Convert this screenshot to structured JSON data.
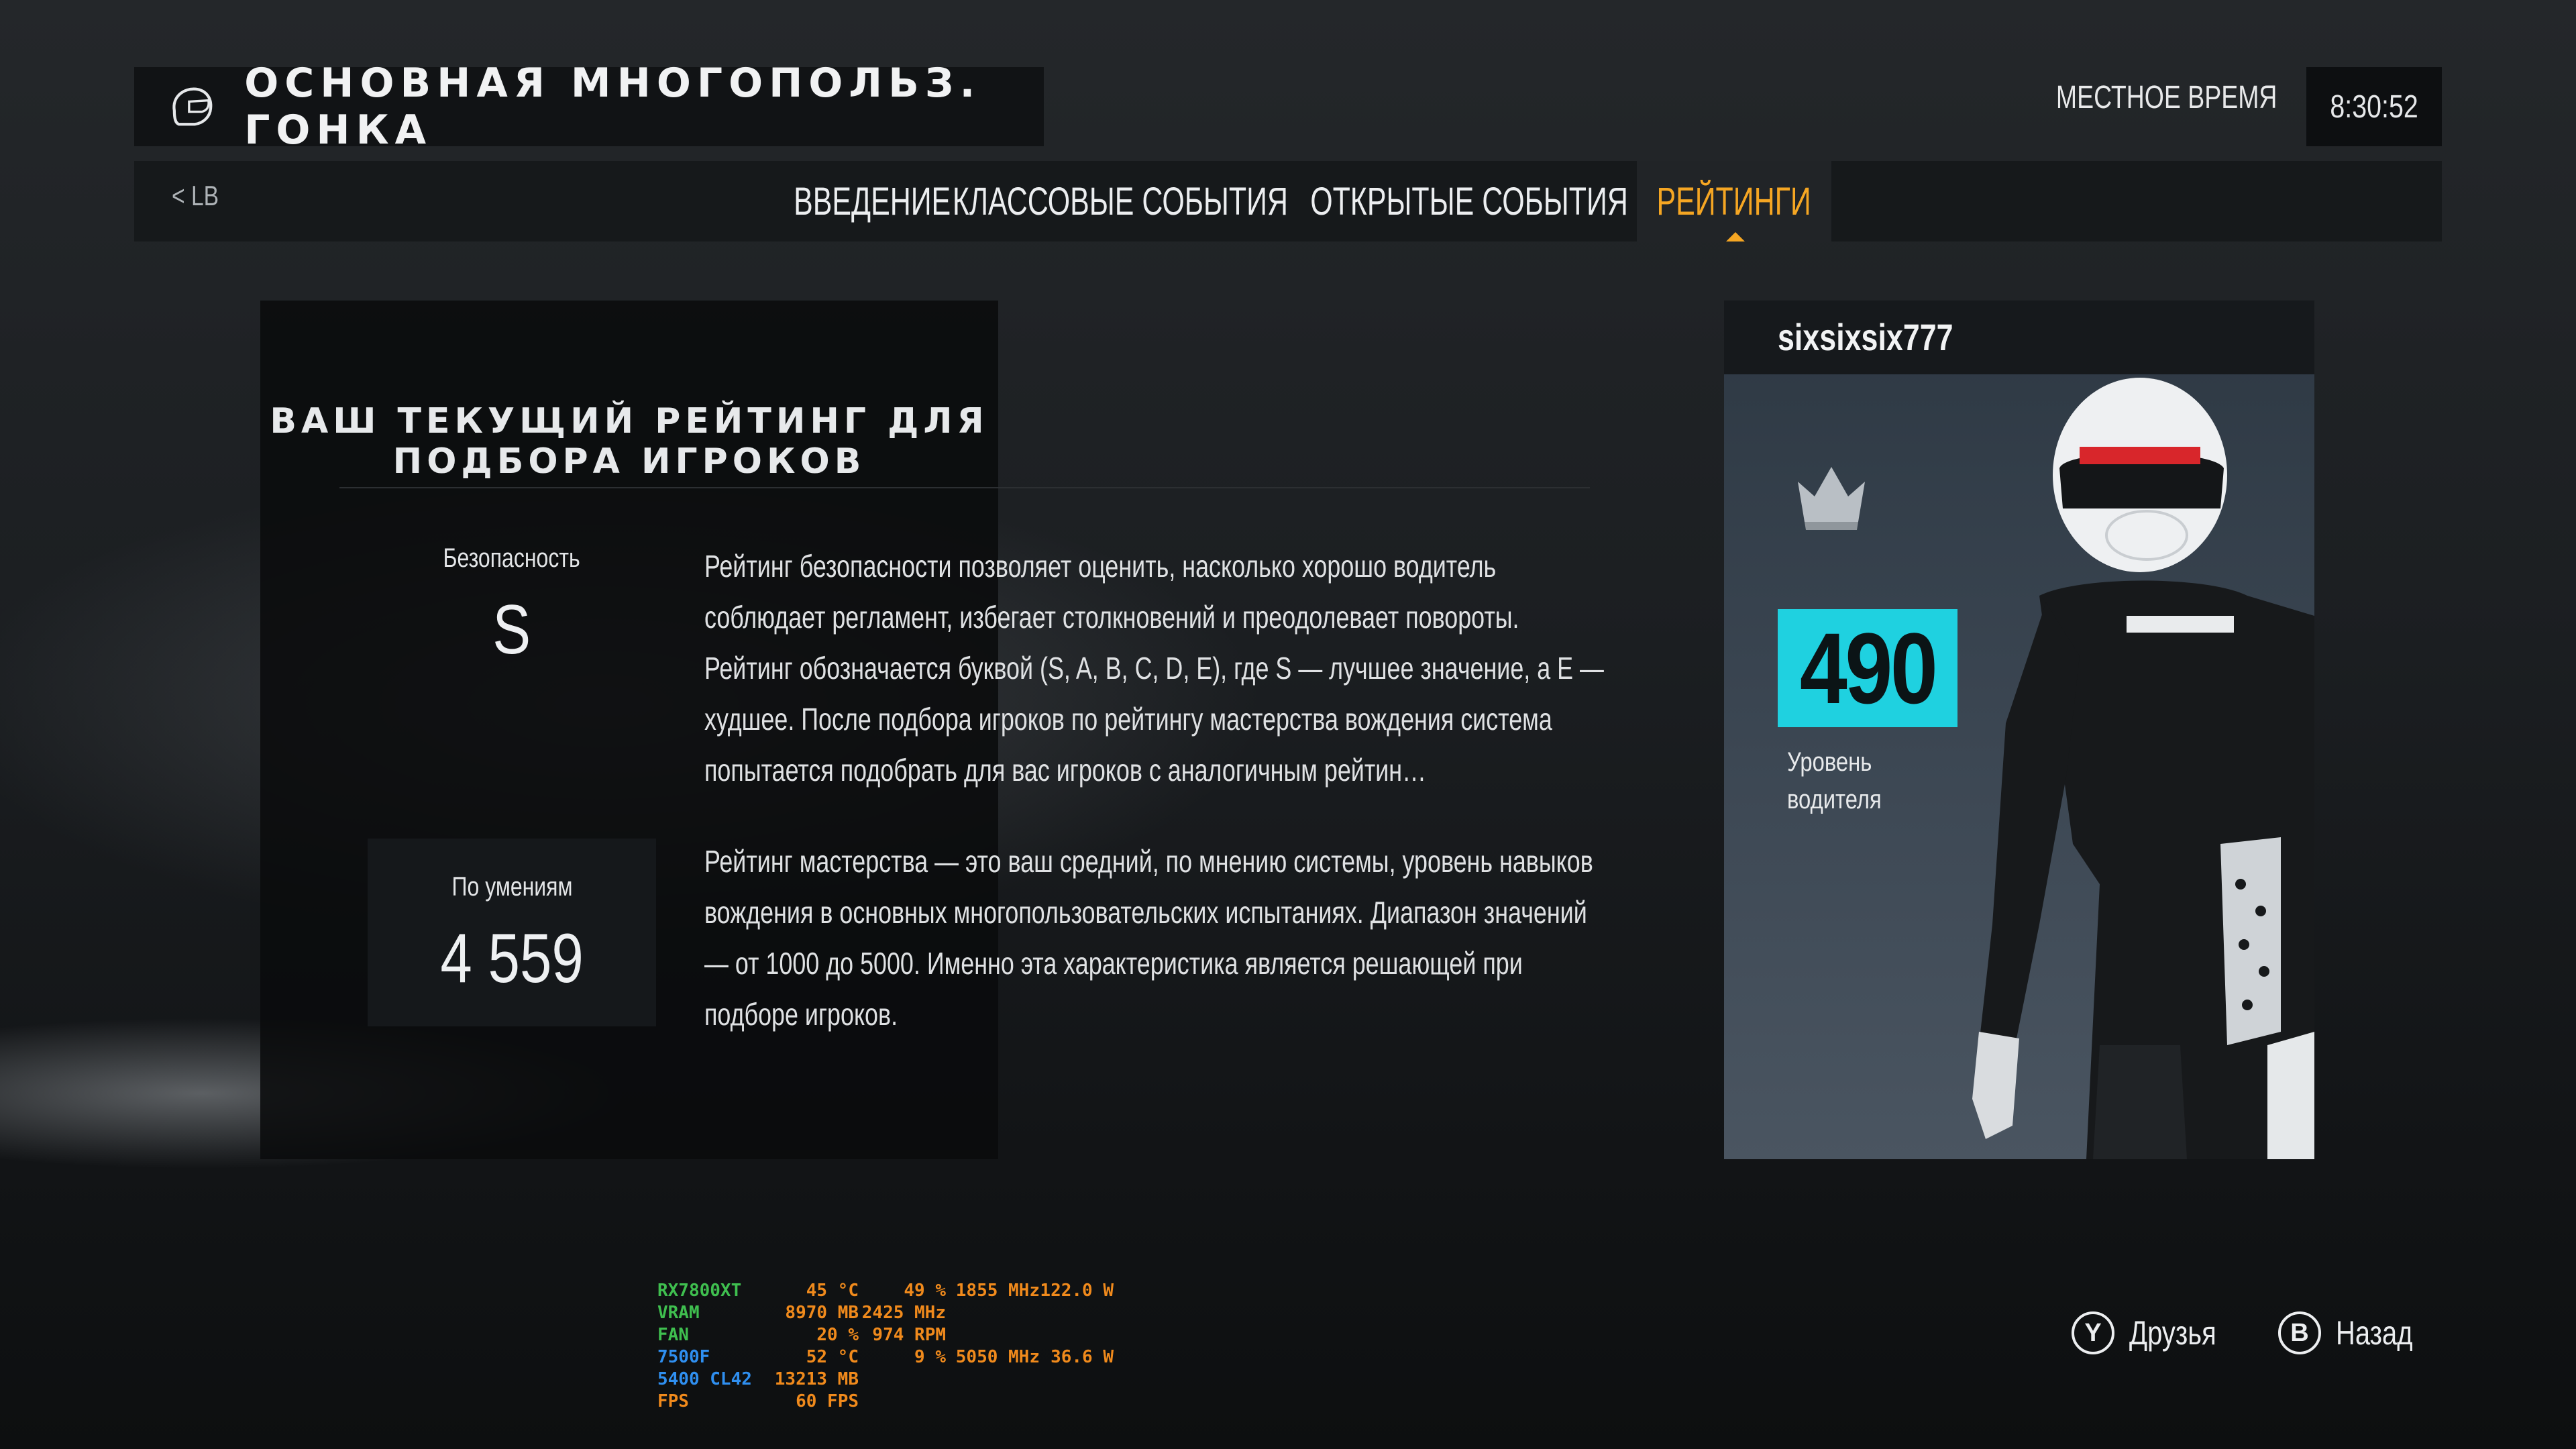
{
  "header": {
    "title": "ОСНОВНАЯ МНОГОПОЛЬЗ. ГОНКА",
    "local_time_label": "МЕСТНОЕ ВРЕМЯ",
    "time": "8:30:52"
  },
  "nav": {
    "bumper_left": "< LB",
    "tabs": [
      {
        "label": "ВВЕДЕНИЕ",
        "active": false
      },
      {
        "label": "КЛАССОВЫЕ СОБЫТИЯ",
        "active": false
      },
      {
        "label": "ОТКРЫТЫЕ СОБЫТИЯ",
        "active": false
      },
      {
        "label": "РЕЙТИНГИ",
        "active": true
      }
    ],
    "active_color": "#f5a623"
  },
  "rating": {
    "heading": "ВАШ ТЕКУЩИЙ РЕЙТИНГ ДЛЯ ПОДБОРА ИГРОКОВ",
    "safety": {
      "label": "Безопасность",
      "value": "S",
      "description": "Рейтинг безопасности позволяет оценить, насколько хорошо водитель соблюдает регламент, избегает столкновений и преодолевает повороты. Рейтинг обозначается буквой (S, A, B, C, D, E), где S — лучшее значение, а E — худшее. После подбора игроков по рейтингу мастерства вождения система попытается подобрать для вас игроков с аналогичным рейтин…"
    },
    "skill": {
      "label": "По умениям",
      "value": "4 559",
      "description": "Рейтинг мастерства — это ваш средний, по мнению системы, уровень навыков вождения в основных многопользовательских испытаниях. Диапазон значений — от 1000 до 5000. Именно эта характеристика является решающей при подборе игроков."
    }
  },
  "driver": {
    "name": "sixsixsix777",
    "level": "490",
    "level_label": "Уровень водителя",
    "badge_color": "#1fd1e0",
    "crown_icon": "crown-icon"
  },
  "hw_overlay": {
    "rows": [
      {
        "key": "RX7800XT",
        "key_color": "#3fbf4f",
        "c1": "45 °C",
        "c2": "49 %",
        "c3": "1855 MHz",
        "c4": "122.0 W"
      },
      {
        "key": "VRAM",
        "key_color": "#3fbf4f",
        "c1": "8970 MB",
        "c2": "2425 MHz",
        "c3": "",
        "c4": ""
      },
      {
        "key": "FAN",
        "key_color": "#3fbf4f",
        "c1": "20 %",
        "c2": "974 RPM",
        "c3": "",
        "c4": ""
      },
      {
        "key": "7500F",
        "key_color": "#2f8ff0",
        "c1": "52 °C",
        "c2": "9 %",
        "c3": "5050 MHz",
        "c4": "36.6 W"
      },
      {
        "key": "5400 CL42",
        "key_color": "#2f8ff0",
        "c1": "13213 MB",
        "c2": "",
        "c3": "",
        "c4": ""
      },
      {
        "key": "FPS",
        "key_color": "#f08a1c",
        "c1": "60 FPS",
        "c2": "",
        "c3": "",
        "c4": ""
      }
    ]
  },
  "footer": {
    "friends": {
      "button": "Y",
      "label": "Друзья"
    },
    "back": {
      "button": "B",
      "label": "Назад"
    }
  }
}
